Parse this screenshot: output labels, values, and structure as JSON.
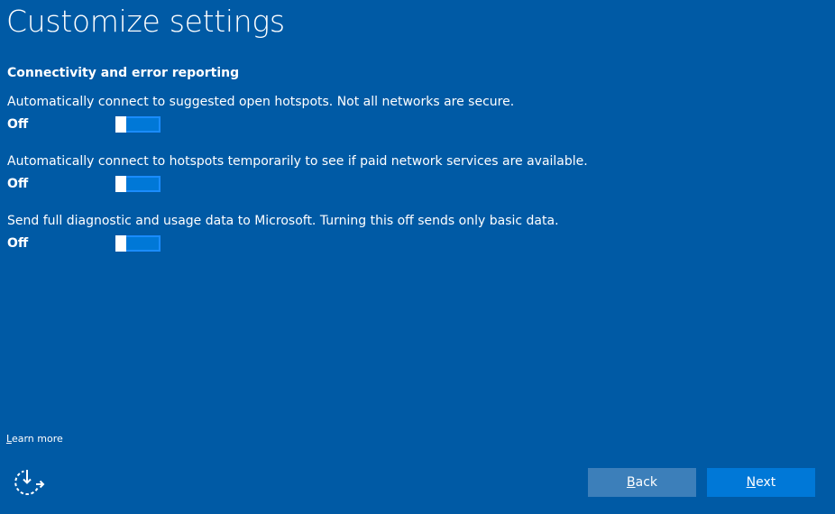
{
  "page": {
    "title": "Customize settings"
  },
  "section": {
    "heading": "Connectivity and error reporting"
  },
  "settings": [
    {
      "description": "Automatically connect to suggested open hotspots. Not all networks are secure.",
      "state": "Off",
      "on": false
    },
    {
      "description": "Automatically connect to hotspots temporarily to see if paid network services are available.",
      "state": "Off",
      "on": false
    },
    {
      "description": "Send full diagnostic and usage data to Microsoft. Turning this off sends only basic data.",
      "state": "Off",
      "on": false
    }
  ],
  "learn_more": {
    "accesskey": "L",
    "rest": "earn more"
  },
  "buttons": {
    "back": {
      "accesskey": "B",
      "rest": "ack"
    },
    "next": {
      "accesskey": "N",
      "rest": "ext"
    }
  },
  "icons": {
    "ease_of_access": "ease-of-access-icon"
  },
  "colors": {
    "background": "#005aa5",
    "toggle_track": "#0078d7",
    "toggle_border": "#1a8cff",
    "back_button": "#3c7fba",
    "next_button": "#0078d7",
    "text": "#ffffff"
  }
}
